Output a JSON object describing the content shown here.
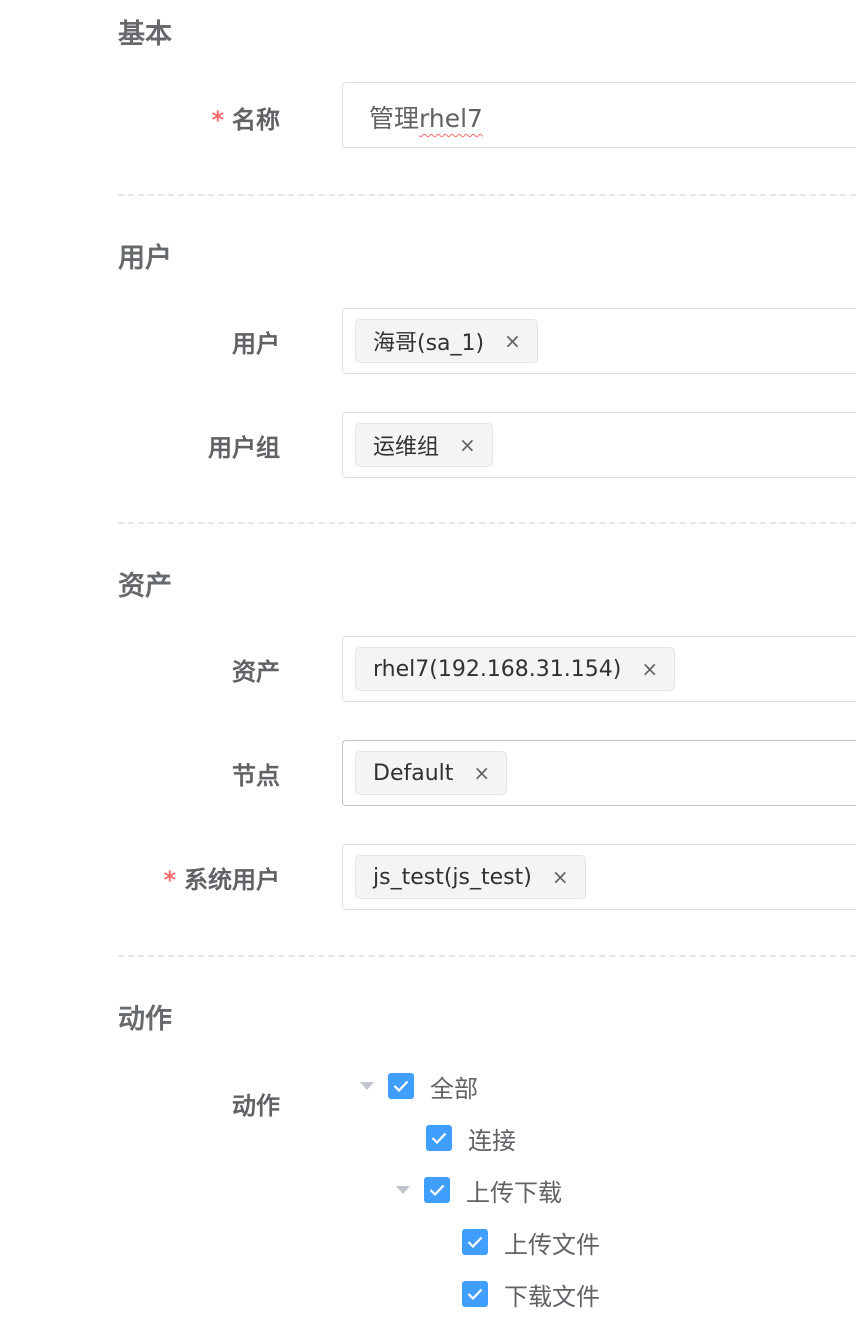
{
  "sections": {
    "basic": "基本",
    "user": "用户",
    "asset": "资产",
    "action": "动作"
  },
  "fields": {
    "name": {
      "required_mark": "*",
      "label": "名称",
      "value_prefix": "管理",
      "value_suffix": "rhel7"
    },
    "users": {
      "label": "用户",
      "tag": "海哥(sa_1)",
      "close": "×"
    },
    "user_groups": {
      "label": "用户组",
      "tag": "运维组",
      "close": "×"
    },
    "assets": {
      "label": "资产",
      "tag": "rhel7(192.168.31.154)",
      "close": "×"
    },
    "nodes": {
      "label": "节点",
      "tag": "Default",
      "close": "×"
    },
    "system_users": {
      "required_mark": "*",
      "label": "系统用户",
      "tag": "js_test(js_test)",
      "close": "×"
    },
    "actions": {
      "label": "动作"
    }
  },
  "action_tree": {
    "all": {
      "label": "全部",
      "checked": true,
      "expanded": true
    },
    "connect": {
      "label": "连接",
      "checked": true
    },
    "upload_download": {
      "label": "上传下载",
      "checked": true,
      "expanded": true
    },
    "upload_file": {
      "label": "上传文件",
      "checked": true
    },
    "download_file": {
      "label": "下载文件",
      "checked": true
    }
  },
  "colors": {
    "required": "#f56c6c",
    "checkbox": "#409eff",
    "border": "#dcdfe6"
  }
}
